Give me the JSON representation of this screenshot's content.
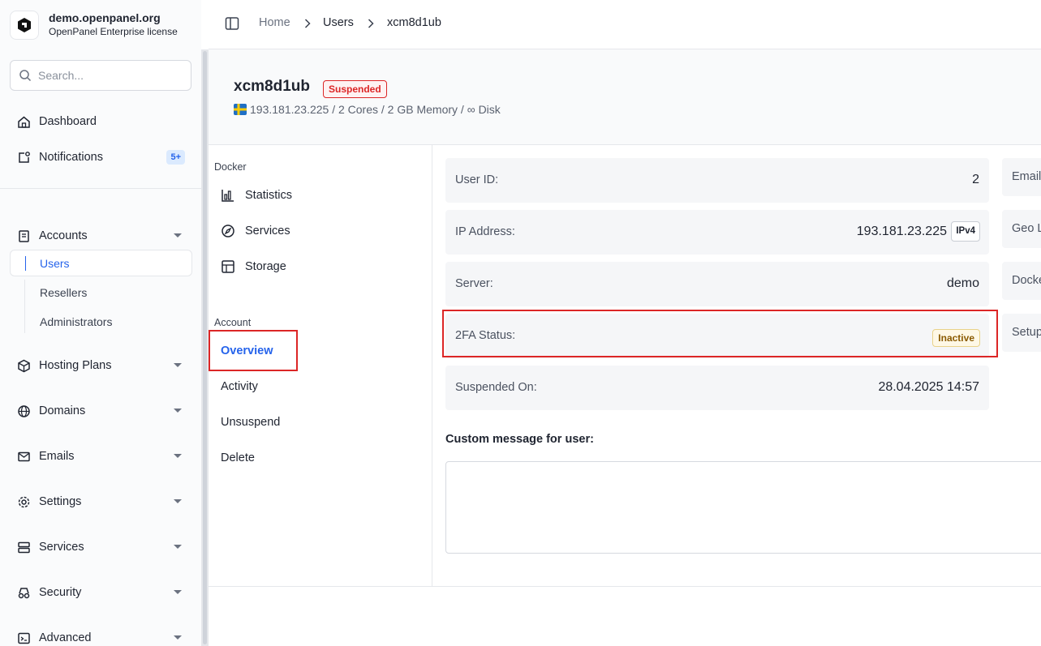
{
  "brand": {
    "title": "demo.openpanel.org",
    "subtitle": "OpenPanel Enterprise license"
  },
  "search": {
    "placeholder": "Search..."
  },
  "sidebar": {
    "dashboard": "Dashboard",
    "notifications": "Notifications",
    "notifications_badge": "5+",
    "accounts": "Accounts",
    "accounts_sub": [
      "Users",
      "Resellers",
      "Administrators"
    ],
    "hosting_plans": "Hosting Plans",
    "domains": "Domains",
    "emails": "Emails",
    "settings": "Settings",
    "services": "Services",
    "security": "Security",
    "advanced": "Advanced"
  },
  "breadcrumb": [
    "Home",
    "Users",
    "xcm8d1ub"
  ],
  "user": {
    "name": "xcm8d1ub",
    "status": "Suspended",
    "meta": "193.181.23.225 / 2 Cores / 2 GB Memory / ∞ Disk"
  },
  "secnav": {
    "docker_label": "Docker",
    "docker_items": [
      "Statistics",
      "Services",
      "Storage"
    ],
    "account_label": "Account",
    "account_items": [
      "Overview",
      "Activity",
      "Unsuspend",
      "Delete"
    ]
  },
  "details": {
    "user_id_label": "User ID:",
    "user_id": "2",
    "ip_label": "IP Address:",
    "ip": "193.181.23.225",
    "ip_type": "IPv4",
    "server_label": "Server:",
    "server": "demo",
    "twofa_label": "2FA Status:",
    "twofa": "Inactive",
    "suspended_label": "Suspended On:",
    "suspended": "28.04.2025 14:57"
  },
  "right_cards": [
    "Email",
    "Geo L",
    "Docke",
    "Setup"
  ],
  "custom_message": {
    "label": "Custom message for user:",
    "value": ""
  },
  "colors": {
    "accent": "#2563eb",
    "danger": "#dc2626",
    "warning_bg": "#fef8e6"
  }
}
